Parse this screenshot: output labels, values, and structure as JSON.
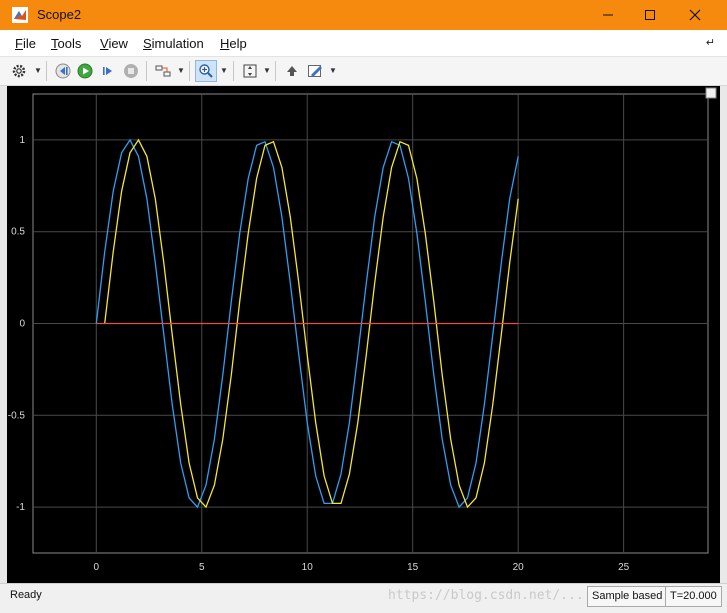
{
  "window": {
    "title": "Scope2",
    "icon": "matlab-logo-icon",
    "controls": [
      "minimize-icon",
      "maximize-icon",
      "close-icon"
    ],
    "title_bar_color": "#f58a0f"
  },
  "menu": {
    "items": [
      {
        "mnemonic": "F",
        "rest": "ile"
      },
      {
        "mnemonic": "T",
        "rest": "ools"
      },
      {
        "mnemonic": "V",
        "rest": "iew"
      },
      {
        "mnemonic": "S",
        "rest": "imulation"
      },
      {
        "mnemonic": "H",
        "rest": "elp"
      }
    ]
  },
  "toolbar": {
    "icons": [
      "settings-gear-icon",
      "step-back-icon",
      "run-icon",
      "step-forward-icon",
      "stop-icon",
      "signal-selector-icon",
      "zoom-in-icon",
      "autoscale-icon",
      "highlight-block-icon",
      "edit-style-icon"
    ]
  },
  "plot": {
    "background": "#000000",
    "grid_color": "#4a4a4a",
    "series_colors": [
      "#2e9ef3",
      "#f5e633",
      "#e8503c"
    ]
  },
  "chart_data": {
    "type": "line",
    "title": "",
    "xlabel": "",
    "ylabel": "",
    "xlim": [
      -3,
      29
    ],
    "ylim": [
      -1.25,
      1.25
    ],
    "x_ticks": [
      0,
      5,
      10,
      15,
      20,
      25
    ],
    "y_ticks": [
      1,
      0.5,
      0,
      -0.5,
      -1
    ],
    "y_tick_labels": [
      "1",
      "0.5",
      "0",
      "-0.5",
      "-1"
    ],
    "grid": true,
    "series": [
      {
        "color": "#2e9ef3",
        "x": [
          0,
          0.4,
          0.8,
          1.2,
          1.6,
          2.0,
          2.4,
          2.8,
          3.2,
          3.6,
          4.0,
          4.4,
          4.8,
          5.2,
          5.6,
          6.0,
          6.4,
          6.8,
          7.2,
          7.6,
          8.0,
          8.4,
          8.8,
          9.2,
          9.6,
          10.0,
          10.4,
          10.8,
          11.2,
          11.6,
          12.0,
          12.4,
          12.8,
          13.2,
          13.6,
          14.0,
          14.4,
          14.8,
          15.2,
          15.6,
          16.0,
          16.4,
          16.8,
          17.2,
          17.6,
          18.0,
          18.4,
          18.8,
          19.2,
          19.6,
          20.0
        ],
        "y": [
          0,
          0.39,
          0.72,
          0.93,
          1.0,
          0.91,
          0.68,
          0.33,
          -0.06,
          -0.44,
          -0.76,
          -0.95,
          -1.0,
          -0.88,
          -0.63,
          -0.28,
          0.12,
          0.49,
          0.79,
          0.97,
          0.99,
          0.85,
          0.58,
          0.22,
          -0.17,
          -0.54,
          -0.83,
          -0.98,
          -0.98,
          -0.82,
          -0.54,
          -0.17,
          0.22,
          0.58,
          0.85,
          0.99,
          0.97,
          0.79,
          0.49,
          0.12,
          -0.28,
          -0.63,
          -0.88,
          -1.0,
          -0.95,
          -0.76,
          -0.44,
          -0.06,
          0.33,
          0.68,
          0.91
        ]
      },
      {
        "color": "#f5e633",
        "x": [
          0.4,
          0.8,
          0.8,
          1.2,
          1.2,
          1.6,
          1.6,
          2.0,
          2.4,
          2.8,
          3.2,
          3.6,
          4.0,
          4.0,
          4.4,
          4.8,
          5.2,
          5.2,
          5.6,
          6.0,
          6.4,
          6.8,
          7.2,
          7.2,
          7.6,
          8.0,
          8.4,
          8.8,
          9.2,
          9.6,
          10.0,
          10.4,
          10.4,
          10.8,
          11.2,
          11.6,
          12.0,
          12.4,
          12.8,
          13.2,
          13.6,
          13.6,
          14.0,
          14.4,
          14.8,
          15.2,
          15.6,
          16.0,
          16.4,
          16.8,
          16.8,
          17.2,
          17.6,
          18.0,
          18.4,
          18.8,
          19.2,
          19.6,
          19.6,
          20.0
        ],
        "y": [
          0,
          0.39,
          0.39,
          0.72,
          0.72,
          0.93,
          0.93,
          1.0,
          0.91,
          0.68,
          0.33,
          -0.06,
          -0.44,
          -0.44,
          -0.76,
          -0.95,
          -1.0,
          -1.0,
          -0.88,
          -0.63,
          -0.28,
          0.12,
          0.49,
          0.49,
          0.79,
          0.97,
          0.99,
          0.85,
          0.58,
          0.22,
          -0.17,
          -0.54,
          -0.54,
          -0.83,
          -0.98,
          -0.98,
          -0.82,
          -0.54,
          -0.17,
          0.22,
          0.58,
          0.58,
          0.85,
          0.99,
          0.97,
          0.79,
          0.49,
          0.12,
          -0.28,
          -0.63,
          -0.63,
          -0.88,
          -1.0,
          -0.95,
          -0.76,
          -0.44,
          -0.06,
          0.33,
          0.33,
          0.68
        ]
      },
      {
        "color": "#e8503c",
        "x": [
          0,
          20
        ],
        "y": [
          0,
          0
        ]
      }
    ]
  },
  "status": {
    "ready": "Ready",
    "sample_mode": "Sample based",
    "time": "T=20.000",
    "watermark": "https://blog.csdn.net/..."
  }
}
